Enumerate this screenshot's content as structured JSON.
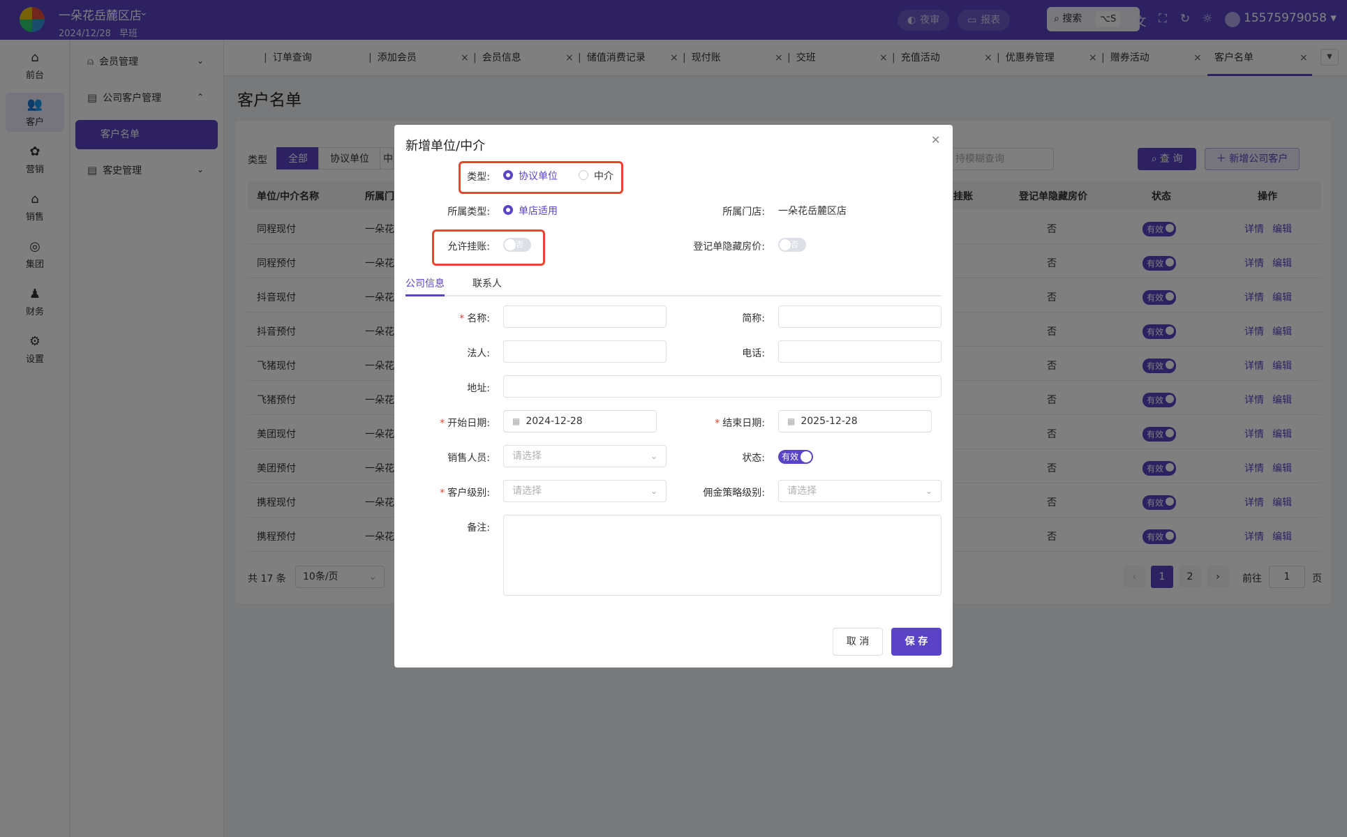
{
  "topbar": {
    "store_name": "一朵花岳麓区店",
    "date": "2024/12/28",
    "shift": "早班",
    "night_audit": "夜审",
    "report": "报表",
    "search_label": "搜索",
    "search_shortcut": "⌥S",
    "user": "15575979058"
  },
  "rail": [
    {
      "label": "前台",
      "icon": "home-icon"
    },
    {
      "label": "客户",
      "icon": "users-icon"
    },
    {
      "label": "营销",
      "icon": "marketing-icon"
    },
    {
      "label": "销售",
      "icon": "sales-icon"
    },
    {
      "label": "集团",
      "icon": "globe-icon"
    },
    {
      "label": "财务",
      "icon": "money-bag-icon"
    },
    {
      "label": "设置",
      "icon": "settings-icon"
    }
  ],
  "subbar": {
    "member_mgmt": "会员管理",
    "company_mgmt": "公司客户管理",
    "customer_list": "客户名单",
    "history_mgmt": "客史管理"
  },
  "tabs": [
    "订单查询",
    "添加会员",
    "会员信息",
    "储值消费记录",
    "现付账",
    "交班",
    "充值活动",
    "优惠券管理",
    "赠券活动",
    "客户名单"
  ],
  "page": {
    "title": "客户名单",
    "filter_label": "类型",
    "filter_all": "全部",
    "filter_agreement": "协议单位",
    "filter_agent": "中",
    "search_placeholder": "持模糊查询",
    "query_button": "查 询",
    "add_button": "新增公司客户"
  },
  "table": {
    "headers": [
      "单位/中介名称",
      "所属门",
      "挂账",
      "登记单隐藏房价",
      "状态",
      "操作"
    ],
    "rows": [
      {
        "name": "同程现付",
        "store": "一朵花",
        "hide": "否",
        "status": "有效"
      },
      {
        "name": "同程预付",
        "store": "一朵花",
        "hide": "否",
        "status": "有效"
      },
      {
        "name": "抖音现付",
        "store": "一朵花",
        "hide": "否",
        "status": "有效"
      },
      {
        "name": "抖音预付",
        "store": "一朵花",
        "hide": "否",
        "status": "有效"
      },
      {
        "name": "飞猪现付",
        "store": "一朵花",
        "hide": "否",
        "status": "有效"
      },
      {
        "name": "飞猪预付",
        "store": "一朵花",
        "hide": "否",
        "status": "有效"
      },
      {
        "name": "美团现付",
        "store": "一朵花",
        "hide": "否",
        "status": "有效"
      },
      {
        "name": "美团预付",
        "store": "一朵花",
        "hide": "否",
        "status": "有效"
      },
      {
        "name": "携程现付",
        "store": "一朵花",
        "hide": "否",
        "status": "有效"
      },
      {
        "name": "携程预付",
        "store": "一朵花",
        "hide": "否",
        "status": "有效"
      }
    ],
    "op_detail": "详情",
    "op_edit": "编辑"
  },
  "pager": {
    "total": "共 17 条",
    "size": "10条/页",
    "pages": [
      "1",
      "2"
    ],
    "goto": "前往",
    "goto_value": "1",
    "page_unit": "页"
  },
  "dialog": {
    "title": "新增单位/中介",
    "type_label": "类型:",
    "type_agreement": "协议单位",
    "type_agent": "中介",
    "belong_type_label": "所属类型:",
    "belong_type_value": "单店适用",
    "belong_store_label": "所属门店:",
    "belong_store_value": "一朵花岳麓区店",
    "allow_credit_label": "允许挂账:",
    "allow_credit_value": "否",
    "hide_price_label": "登记单隐藏房价:",
    "hide_price_value": "否",
    "tab_company": "公司信息",
    "tab_contact": "联系人",
    "name_label": "名称:",
    "short_label": "简称:",
    "legal_label": "法人:",
    "phone_label": "电话:",
    "address_label": "地址:",
    "start_label": "开始日期:",
    "start_value": "2024-12-28",
    "end_label": "结束日期:",
    "end_value": "2025-12-28",
    "sales_label": "销售人员:",
    "status_label": "状态:",
    "status_value": "有效",
    "level_label": "客户级别:",
    "commission_label": "佣金策略级别:",
    "select_placeholder": "请选择",
    "remark_label": "备注:",
    "cancel": "取 消",
    "save": "保 存"
  },
  "colors": {
    "accent": "#5a43c4",
    "highlight": "#e8442e"
  }
}
